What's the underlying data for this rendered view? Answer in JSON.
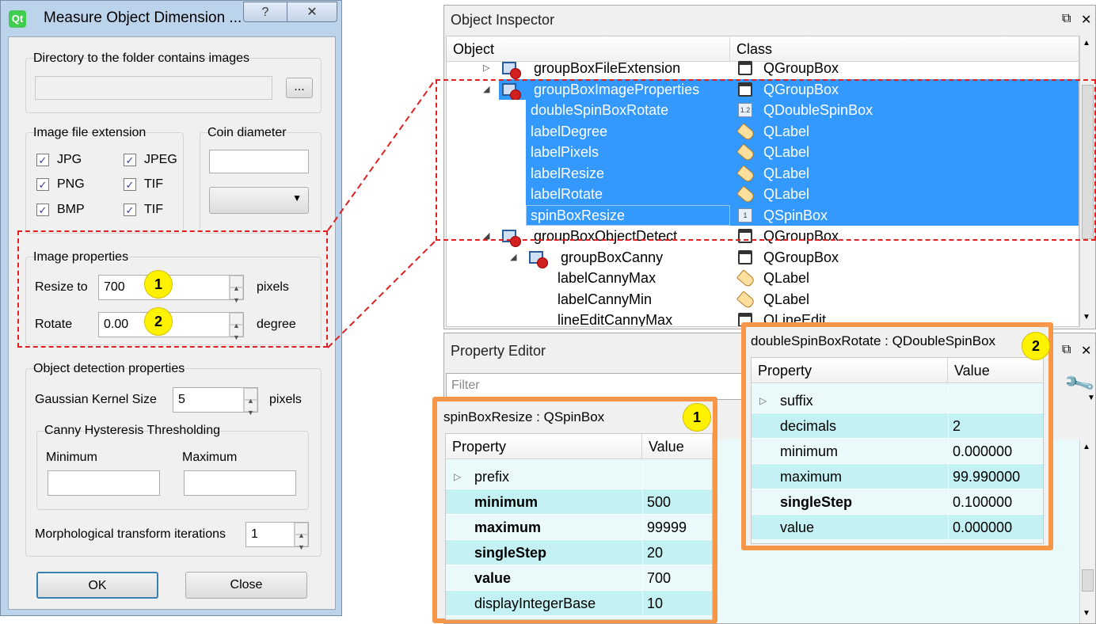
{
  "dialog": {
    "title": "Measure Object Dimension ...",
    "help_button": "?",
    "close_button": "✕",
    "directory_group": "Directory to the folder contains images",
    "browse_button": "...",
    "extension_group": "Image file extension",
    "extensions": [
      "JPG",
      "JPEG",
      "PNG",
      "TIF",
      "BMP",
      "TIF"
    ],
    "coin_group": "Coin diameter",
    "image_props_group": "Image properties",
    "resize_label": "Resize to",
    "resize_value": "700",
    "resize_unit": "pixels",
    "rotate_label": "Rotate",
    "rotate_value": "0.00",
    "rotate_unit": "degree",
    "detection_group": "Object detection properties",
    "gaussian_label": "Gaussian Kernel Size",
    "gaussian_value": "5",
    "gaussian_unit": "pixels",
    "canny_group": "Canny Hysteresis Thresholding",
    "canny_min": "Minimum",
    "canny_max": "Maximum",
    "morph_label": "Morphological transform iterations",
    "morph_value": "1",
    "ok_button": "OK",
    "close_btn": "Close"
  },
  "badges": {
    "one": "1",
    "two": "2"
  },
  "inspector": {
    "title": "Object Inspector",
    "col_object": "Object",
    "col_class": "Class",
    "rows": [
      {
        "object": "groupBoxFileExtension",
        "class": "QGroupBox"
      },
      {
        "object": "groupBoxImageProperties",
        "class": "QGroupBox"
      },
      {
        "object": "doubleSpinBoxRotate",
        "class": "QDoubleSpinBox"
      },
      {
        "object": "labelDegree",
        "class": "QLabel"
      },
      {
        "object": "labelPixels",
        "class": "QLabel"
      },
      {
        "object": "labelResize",
        "class": "QLabel"
      },
      {
        "object": "labelRotate",
        "class": "QLabel"
      },
      {
        "object": "spinBoxResize",
        "class": "QSpinBox"
      },
      {
        "object": "groupBoxObjectDetect",
        "class": "QGroupBox"
      },
      {
        "object": "groupBoxCanny",
        "class": "QGroupBox"
      },
      {
        "object": "labelCannyMax",
        "class": "QLabel"
      },
      {
        "object": "labelCannyMin",
        "class": "QLabel"
      },
      {
        "object": "lineEditCannyMax",
        "class": "QLineEdit"
      }
    ]
  },
  "property_editor": {
    "title": "Property Editor",
    "filter_placeholder": "Filter",
    "spinbox_panel": {
      "header": "spinBoxResize : QSpinBox",
      "col_property": "Property",
      "col_value": "Value",
      "rows": [
        {
          "property": "prefix",
          "value": ""
        },
        {
          "property": "minimum",
          "value": "500"
        },
        {
          "property": "maximum",
          "value": "99999"
        },
        {
          "property": "singleStep",
          "value": "20"
        },
        {
          "property": "value",
          "value": "700"
        },
        {
          "property": "displayIntegerBase",
          "value": "10"
        }
      ]
    },
    "double_panel": {
      "header": "doubleSpinBoxRotate : QDoubleSpinBox",
      "col_property": "Property",
      "col_value": "Value",
      "rows": [
        {
          "property": "suffix",
          "value": ""
        },
        {
          "property": "decimals",
          "value": "2"
        },
        {
          "property": "minimum",
          "value": "0.000000"
        },
        {
          "property": "maximum",
          "value": "99.990000"
        },
        {
          "property": "singleStep",
          "value": "0.100000"
        },
        {
          "property": "value",
          "value": "0.000000"
        }
      ]
    }
  },
  "colors": {
    "selection": "#3399ff",
    "callout_red": "#e02020",
    "callout_orange": "#f79646",
    "badge": "#fff200",
    "changed_row": "#c4f2f4"
  }
}
